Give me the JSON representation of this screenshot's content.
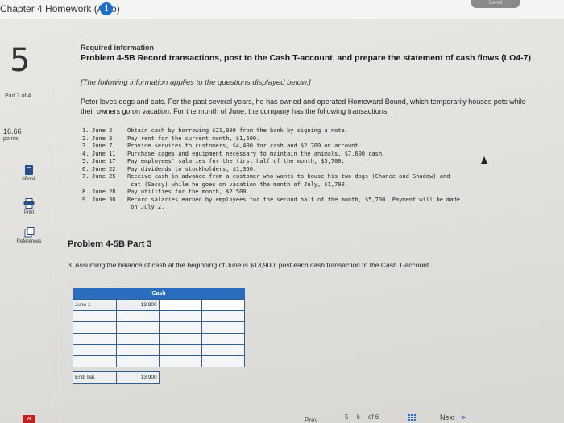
{
  "header": {
    "title": "Chapter 4 Homework (Algo)",
    "info_icon": "info-icon",
    "saved": "Saved"
  },
  "sidebar": {
    "question_number": "5",
    "part": "Part 3 of 4",
    "points_value": "16.66",
    "points_label": "points",
    "tools": [
      {
        "label": "eBook",
        "icon": "ebook-icon"
      },
      {
        "label": "Print",
        "icon": "print-icon"
      },
      {
        "label": "References",
        "icon": "references-icon"
      }
    ]
  },
  "problem": {
    "required_title": "Required information",
    "heading": "Problem 4-5B Record transactions, post to the Cash T-account, and prepare the statement of cash flows (LO4-7)",
    "applies_note": "[The following information applies to the questions displayed below.]",
    "intro": "Peter loves dogs and cats. For the past several years, he has owned and operated Homeward Bound, which temporarily houses pets while their owners go on vacation. For the month of June, the company has the following transactions:",
    "transactions": [
      {
        "num": "1.",
        "date": "June  2",
        "text": "Obtain cash by borrowing $21,000 from the bank by signing a note."
      },
      {
        "num": "2.",
        "date": "June  3",
        "text": "Pay rent for the current month, $1,500."
      },
      {
        "num": "3.",
        "date": "June  7",
        "text": "Provide services to customers, $4,400 for cash and $2,700 on account."
      },
      {
        "num": "4.",
        "date": "June 11",
        "text": "Purchase cages and equipment necessary to maintain the animals, $7,600 cash."
      },
      {
        "num": "5.",
        "date": "June 17",
        "text": "Pay employees' salaries for the first half of the month, $5,700."
      },
      {
        "num": "6.",
        "date": "June 22",
        "text": "Pay dividends to stockholders, $1,350."
      },
      {
        "num": "7.",
        "date": "June 25",
        "text": "Receive cash in advance from a customer who wants to house his two dogs (Chance and Shadow) and\n cat (Sassy) while he goes on vacation the month of July, $1,700."
      },
      {
        "num": "8.",
        "date": "June 28",
        "text": "Pay utilities for the month, $2,500."
      },
      {
        "num": "9.",
        "date": "June 30",
        "text": "Record salaries earned by employees for the second half of the month, $5,700. Payment will be made\n on July 2."
      }
    ]
  },
  "part3": {
    "title": "Problem 4-5B Part 3",
    "instruction": "3. Assuming the balance of cash at the beginning of June is $13,900, post each cash transaction to the Cash T-account.",
    "taccount": {
      "header": "Cash",
      "opening_label": "June 1",
      "opening_amount": "13,900",
      "blank_rows": 5,
      "closing_label": "End. bal.",
      "closing_amount": "13,900"
    }
  },
  "footer": {
    "brand": "Mc",
    "prev": "Prev",
    "current_page": "5",
    "next_page": "6",
    "of_label": "of 6",
    "grid_icon": "grid-icon",
    "next": "Next",
    "next_icon": "chevron-right-icon"
  }
}
